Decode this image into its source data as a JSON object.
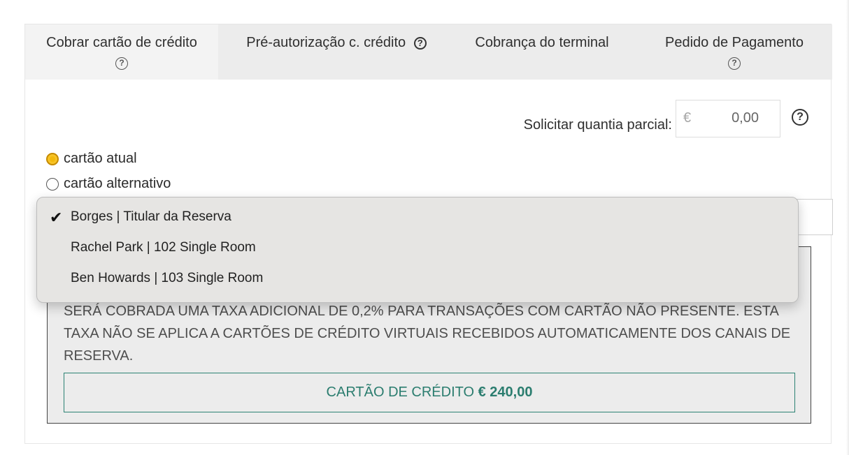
{
  "tabs": [
    {
      "label": "Cobrar cartão de crédito",
      "active": true,
      "help_icon": "question-circle-icon"
    },
    {
      "label": "Pré-autorização c. crédito",
      "active": false,
      "help_icon": "question-circle-icon"
    },
    {
      "label": "Cobrança do terminal",
      "active": false
    },
    {
      "label": "Pedido de Pagamento",
      "active": false,
      "help_icon": "question-circle-icon"
    }
  ],
  "partial": {
    "label": "Solicitar quantia parcial:",
    "currency": "€",
    "value": "0,00",
    "help_icon": "question-circle-icon"
  },
  "card_options": {
    "current": "cartão atual",
    "alternative": "cartão alternativo",
    "selected": "current"
  },
  "dropdown": {
    "items": [
      {
        "label": "Borges | Titular da Reserva",
        "selected": true
      },
      {
        "label": "Rachel Park | 102 Single Room",
        "selected": false
      },
      {
        "label": "Ben Howards | 103 Single Room",
        "selected": false
      }
    ],
    "check_icon": "checkmark-icon"
  },
  "info": {
    "text": "SERÁ COBRADA UMA TAXA ADICIONAL DE 0,2% PARA TRANSAÇÕES COM CARTÃO NÃO PRESENTE. ESTA TAXA NÃO SE APLICA A CARTÕES DE CRÉDITO VIRTUAIS RECEBIDOS AUTOMATICAMENTE DOS CANAIS DE RESERVA."
  },
  "charge_button": {
    "label": "CARTÃO DE CRÉDITO",
    "amount": "€ 240,00"
  },
  "colors": {
    "accent_teal": "#2b7d6f",
    "radio_selected": "#f3b90d"
  }
}
